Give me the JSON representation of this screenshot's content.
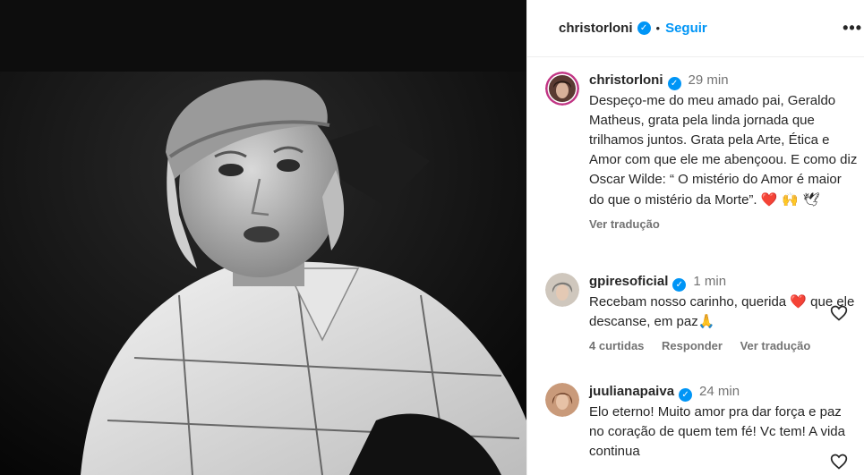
{
  "header": {
    "username": "christorloni",
    "verified_icon": "verified-badge-icon",
    "separator": "•",
    "follow_label": "Seguir",
    "more_label": "•••"
  },
  "caption": {
    "username": "christorloni",
    "time": "29 min",
    "text": "Despeço-me do meu amado pai, Geraldo Matheus, grata pela linda jornada que trilhamos juntos. Grata pela Arte, Ética e Amor com que ele me abençoou. E como diz Oscar Wilde: “ O mistério do Amor é maior do que o mistério da Morte”.",
    "emojis": "❤️ 🙌 🕊",
    "see_translation": "Ver tradução"
  },
  "comments": [
    {
      "username": "gpiresoficial",
      "time": "1 min",
      "text": "Recebam nosso carinho, querida ❤️ que ele descanse, em paz🙏",
      "likes": "4 curtidas",
      "reply": "Responder",
      "see_translation": "Ver tradução"
    },
    {
      "username": "juulianapaiva",
      "time": "24 min",
      "text": "Elo eterno! Muito amor pra dar força e paz no coração de quem tem fé! Vc tem! A vida continua"
    }
  ],
  "colors": {
    "accent": "#0095f6",
    "muted": "#737373",
    "text": "#262626"
  }
}
